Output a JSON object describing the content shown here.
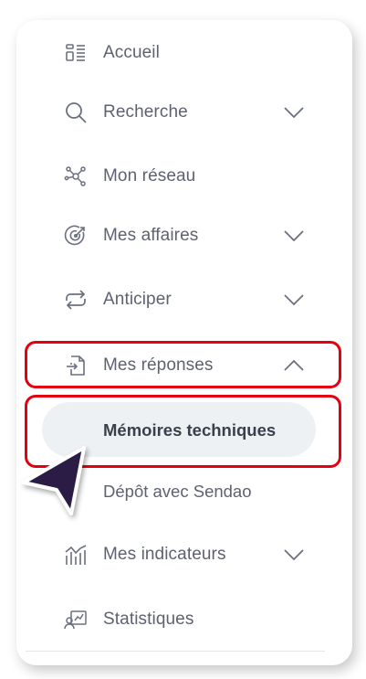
{
  "menu": {
    "items": [
      {
        "label": "Accueil",
        "icon": "dashboard-icon",
        "chevron": null
      },
      {
        "label": "Recherche",
        "icon": "search-icon",
        "chevron": "down"
      },
      {
        "label": "Mon réseau",
        "icon": "network-icon",
        "chevron": null
      },
      {
        "label": "Mes affaires",
        "icon": "target-icon",
        "chevron": "down"
      },
      {
        "label": "Anticiper",
        "icon": "refresh-icon",
        "chevron": "down"
      },
      {
        "label": "Mes réponses",
        "icon": "document-import-icon",
        "chevron": "up"
      },
      {
        "label": "Mes indicateurs",
        "icon": "chart-icon",
        "chevron": "down"
      },
      {
        "label": "Statistiques",
        "icon": "stats-user-icon",
        "chevron": null
      }
    ],
    "submenu": {
      "active": "Mémoires techniques",
      "other": "Dépôt avec Sendao"
    }
  },
  "colors": {
    "highlight": "#e3000f",
    "text": "#5d6270",
    "active_text": "#3a3f4a",
    "pill": "#eef1f4",
    "cursor": "#2a1f45"
  }
}
